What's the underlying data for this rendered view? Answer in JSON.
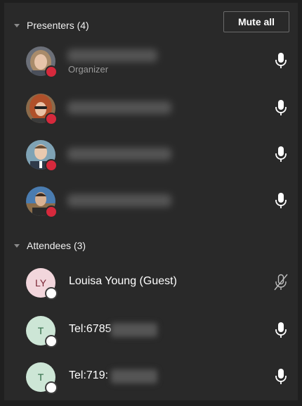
{
  "presenters": {
    "title": "Presenters (4)",
    "mute_all_label": "Mute all",
    "items": [
      {
        "role": "Organizer",
        "status": "busy",
        "mic": "mic-icon"
      },
      {
        "status": "busy",
        "mic": "mic-icon"
      },
      {
        "status": "busy",
        "mic": "mic-icon"
      },
      {
        "status": "busy",
        "mic": "mic-icon"
      }
    ]
  },
  "attendees": {
    "title": "Attendees (3)",
    "items": [
      {
        "initials": "LY",
        "name": "Louisa Young (Guest)",
        "mic": "mic-muted-icon",
        "avatar_bg": "#f2d6dc",
        "avatar_fg": "#7a2636"
      },
      {
        "initials": "T",
        "name": "Tel:6785",
        "mic": "mic-icon",
        "avatar_bg": "#cde6d6",
        "avatar_fg": "#2e6b46"
      },
      {
        "initials": "T",
        "name": "Tel:719:",
        "mic": "mic-icon",
        "avatar_bg": "#cde6d6",
        "avatar_fg": "#2e6b46"
      }
    ]
  },
  "colors": {
    "background": "#292929",
    "status_busy": "#d6293c",
    "text": "#ffffff"
  }
}
